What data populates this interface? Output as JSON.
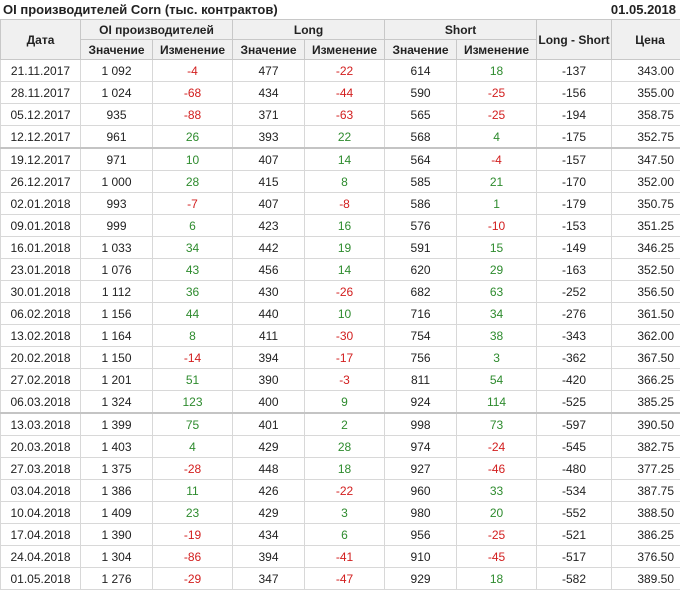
{
  "title": "OI производителей Corn (тыс. контрактов)",
  "date": "01.05.2018",
  "headers": {
    "date": "Дата",
    "oi": "OI производителей",
    "long": "Long",
    "short": "Short",
    "long_short": "Long - Short",
    "price": "Цена",
    "value": "Значение",
    "change": "Изменение"
  },
  "colors": {
    "positive": "#2e8b2e",
    "negative": "#d21e1e",
    "header_bg": "#f0f0f0"
  },
  "group_starts": [
    4,
    16
  ],
  "rows": [
    [
      "21.11.2017",
      "1 092",
      "-4",
      "477",
      "-22",
      "614",
      "18",
      "-137",
      "343.00"
    ],
    [
      "28.11.2017",
      "1 024",
      "-68",
      "434",
      "-44",
      "590",
      "-25",
      "-156",
      "355.00"
    ],
    [
      "05.12.2017",
      "935",
      "-88",
      "371",
      "-63",
      "565",
      "-25",
      "-194",
      "358.75"
    ],
    [
      "12.12.2017",
      "961",
      "26",
      "393",
      "22",
      "568",
      "4",
      "-175",
      "352.75"
    ],
    [
      "19.12.2017",
      "971",
      "10",
      "407",
      "14",
      "564",
      "-4",
      "-157",
      "347.50"
    ],
    [
      "26.12.2017",
      "1 000",
      "28",
      "415",
      "8",
      "585",
      "21",
      "-170",
      "352.00"
    ],
    [
      "02.01.2018",
      "993",
      "-7",
      "407",
      "-8",
      "586",
      "1",
      "-179",
      "350.75"
    ],
    [
      "09.01.2018",
      "999",
      "6",
      "423",
      "16",
      "576",
      "-10",
      "-153",
      "351.25"
    ],
    [
      "16.01.2018",
      "1 033",
      "34",
      "442",
      "19",
      "591",
      "15",
      "-149",
      "346.25"
    ],
    [
      "23.01.2018",
      "1 076",
      "43",
      "456",
      "14",
      "620",
      "29",
      "-163",
      "352.50"
    ],
    [
      "30.01.2018",
      "1 112",
      "36",
      "430",
      "-26",
      "682",
      "63",
      "-252",
      "356.50"
    ],
    [
      "06.02.2018",
      "1 156",
      "44",
      "440",
      "10",
      "716",
      "34",
      "-276",
      "361.50"
    ],
    [
      "13.02.2018",
      "1 164",
      "8",
      "411",
      "-30",
      "754",
      "38",
      "-343",
      "362.00"
    ],
    [
      "20.02.2018",
      "1 150",
      "-14",
      "394",
      "-17",
      "756",
      "3",
      "-362",
      "367.50"
    ],
    [
      "27.02.2018",
      "1 201",
      "51",
      "390",
      "-3",
      "811",
      "54",
      "-420",
      "366.25"
    ],
    [
      "06.03.2018",
      "1 324",
      "123",
      "400",
      "9",
      "924",
      "114",
      "-525",
      "385.25"
    ],
    [
      "13.03.2018",
      "1 399",
      "75",
      "401",
      "2",
      "998",
      "73",
      "-597",
      "390.50"
    ],
    [
      "20.03.2018",
      "1 403",
      "4",
      "429",
      "28",
      "974",
      "-24",
      "-545",
      "382.75"
    ],
    [
      "27.03.2018",
      "1 375",
      "-28",
      "448",
      "18",
      "927",
      "-46",
      "-480",
      "377.25"
    ],
    [
      "03.04.2018",
      "1 386",
      "11",
      "426",
      "-22",
      "960",
      "33",
      "-534",
      "387.75"
    ],
    [
      "10.04.2018",
      "1 409",
      "23",
      "429",
      "3",
      "980",
      "20",
      "-552",
      "388.50"
    ],
    [
      "17.04.2018",
      "1 390",
      "-19",
      "434",
      "6",
      "956",
      "-25",
      "-521",
      "386.25"
    ],
    [
      "24.04.2018",
      "1 304",
      "-86",
      "394",
      "-41",
      "910",
      "-45",
      "-517",
      "376.50"
    ],
    [
      "01.05.2018",
      "1 276",
      "-29",
      "347",
      "-47",
      "929",
      "18",
      "-582",
      "389.50"
    ]
  ]
}
